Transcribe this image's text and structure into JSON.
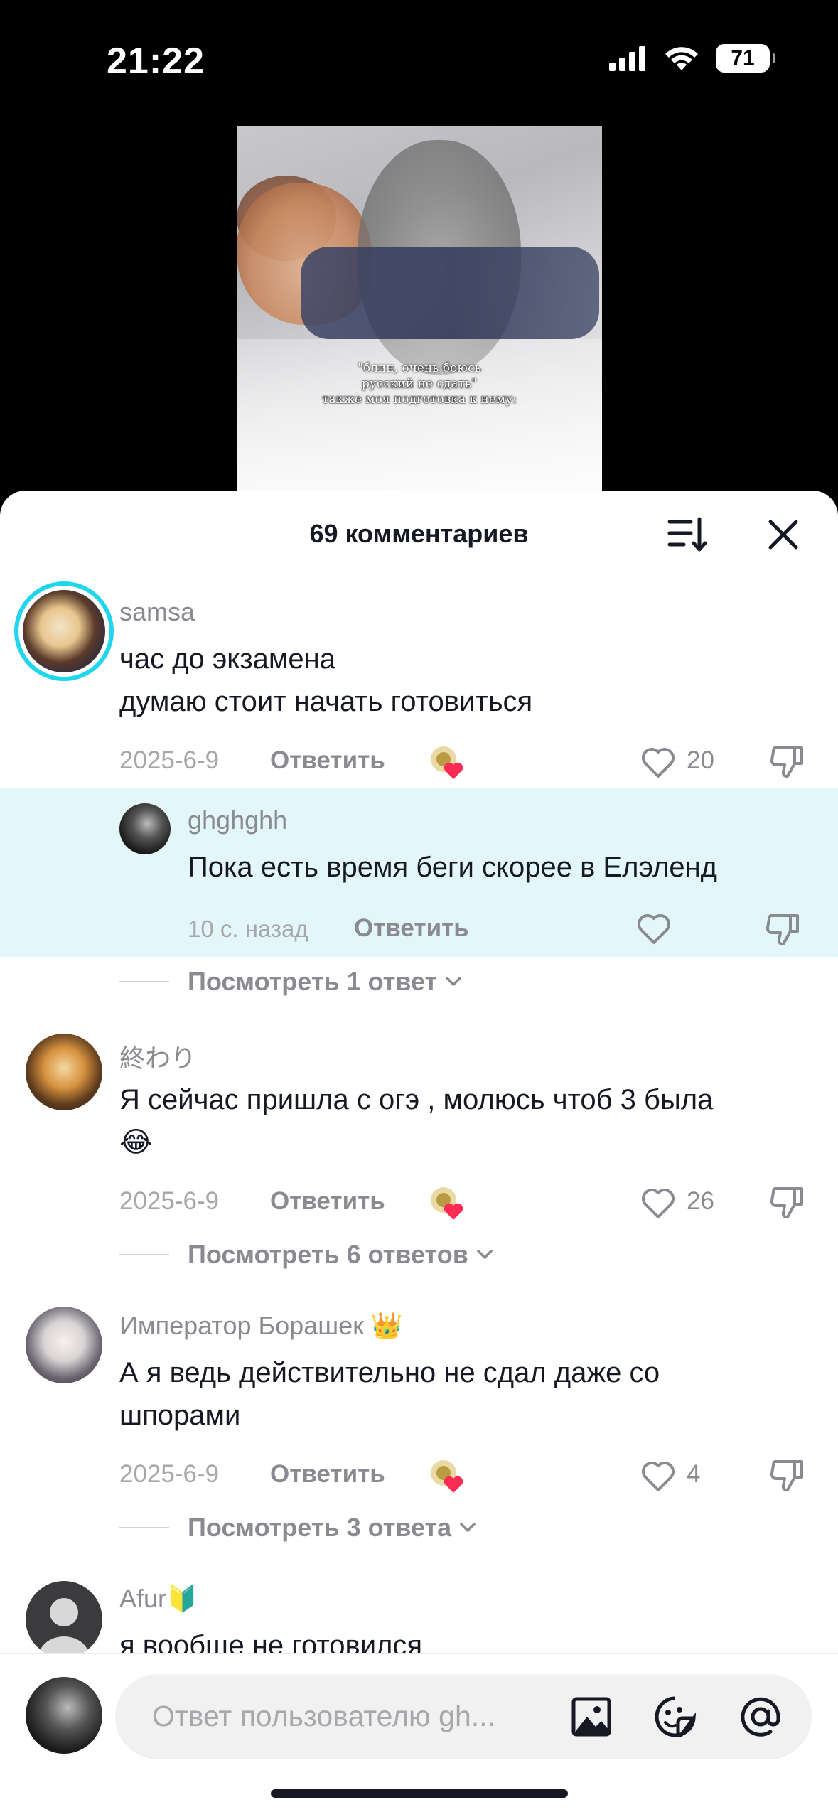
{
  "status_bar": {
    "time": "21:22",
    "battery": "71"
  },
  "video": {
    "caption_lines": [
      "\"блин, очень боюсь",
      "русский не сдать\"",
      "также моя подготовка к нему:"
    ]
  },
  "comments_sheet": {
    "title": "69 комментариев",
    "comments": [
      {
        "username": "samsa",
        "text_lines": [
          "час до экзамена",
          "думаю стоит начать готовиться"
        ],
        "date": "2025-6-9",
        "reply_label": "Ответить",
        "likes": "20"
      },
      {
        "username": "ghghghh",
        "text_lines": [
          "Пока есть время беги скорее в Елэленд"
        ],
        "date": "10 с. назад",
        "reply_label": "Ответить",
        "likes": ""
      },
      {
        "view_replies": "Посмотреть 1 ответ"
      },
      {
        "username": "終わり",
        "text_lines": [
          "Я сейчас пришла с огэ , молюсь чтоб 3 была",
          "😂"
        ],
        "date": "2025-6-9",
        "reply_label": "Ответить",
        "likes": "26",
        "view_replies": "Посмотреть 6 ответов"
      },
      {
        "username": "Император Борашек 👑",
        "text_lines": [
          "А я ведь действительно не сдал даже со",
          "шпорами"
        ],
        "date": "2025-6-9",
        "reply_label": "Ответить",
        "likes": "4",
        "view_replies": "Посмотреть 3 ответа"
      },
      {
        "username": "Afur🔰",
        "text_lines": [
          "я вообще не готовился"
        ]
      }
    ]
  },
  "input": {
    "placeholder": "Ответ пользователю gh..."
  },
  "colors": {
    "like_heart": "#fe2c55",
    "highlight": "#e3f7fb",
    "story_ring": "#20d5ec"
  }
}
